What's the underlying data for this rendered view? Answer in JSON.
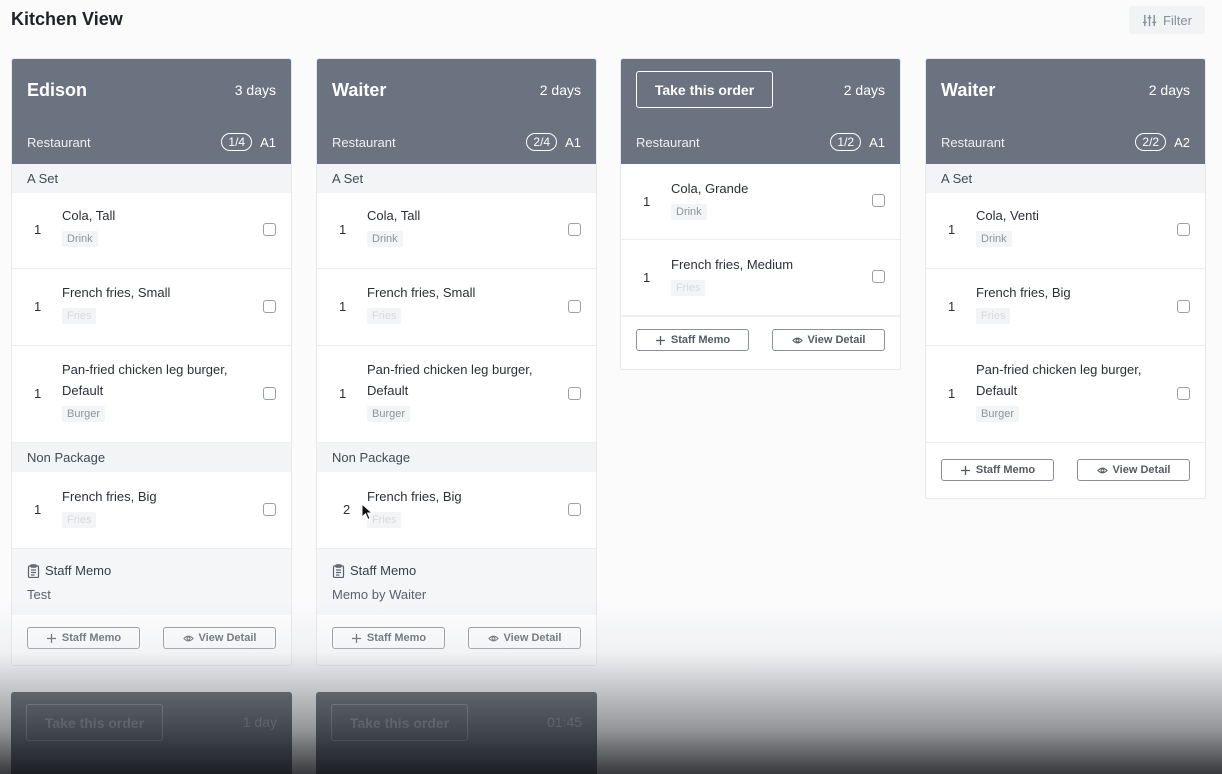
{
  "header": {
    "title": "Kitchen View",
    "filter_label": "Filter"
  },
  "cards": [
    {
      "name": "Edison",
      "days": "3 days",
      "restaurant": "Restaurant",
      "pill": "1/4",
      "table": "A1",
      "groups": [
        {
          "label": "A Set",
          "items": [
            {
              "qty": "1",
              "name": "Cola, Tall",
              "tag": "Drink"
            },
            {
              "qty": "1",
              "name": "French fries, Small",
              "tag": "Fries"
            },
            {
              "qty": "1",
              "name": "Pan-fried chicken leg burger, Default",
              "tag": "Burger"
            }
          ]
        },
        {
          "label": "Non Package",
          "items": [
            {
              "qty": "1",
              "name": "French fries, Big",
              "tag": "Fries"
            }
          ]
        }
      ],
      "memo_title": "Staff Memo",
      "memo_text": "Test",
      "staff_memo_label": "Staff Memo",
      "view_detail_label": "View Detail"
    },
    {
      "name": "Waiter",
      "days": "2 days",
      "restaurant": "Restaurant",
      "pill": "2/4",
      "table": "A1",
      "groups": [
        {
          "label": "A Set",
          "items": [
            {
              "qty": "1",
              "name": "Cola, Tall",
              "tag": "Drink"
            },
            {
              "qty": "1",
              "name": "French fries, Small",
              "tag": "Fries"
            },
            {
              "qty": "1",
              "name": "Pan-fried chicken leg burger, Default",
              "tag": "Burger"
            }
          ]
        },
        {
          "label": "Non Package",
          "items": [
            {
              "qty": "2",
              "name": "French fries, Big",
              "tag": "Fries"
            }
          ]
        }
      ],
      "memo_title": "Staff Memo",
      "memo_text": "Memo by Waiter",
      "staff_memo_label": "Staff Memo",
      "view_detail_label": "View Detail"
    },
    {
      "take_label": "Take this order",
      "days": "2 days",
      "restaurant": "Restaurant",
      "pill": "1/2",
      "table": "A1",
      "items": [
        {
          "qty": "1",
          "name": "Cola, Grande",
          "tag": "Drink"
        },
        {
          "qty": "1",
          "name": "French fries, Medium",
          "tag": "Fries"
        }
      ],
      "staff_memo_label": "Staff Memo",
      "view_detail_label": "View Detail"
    },
    {
      "name": "Waiter",
      "days": "2 days",
      "restaurant": "Restaurant",
      "pill": "2/2",
      "table": "A2",
      "groups": [
        {
          "label": "A Set",
          "items": [
            {
              "qty": "1",
              "name": "Cola, Venti",
              "tag": "Drink"
            },
            {
              "qty": "1",
              "name": "French fries, Big",
              "tag": "Fries"
            },
            {
              "qty": "1",
              "name": "Pan-fried chicken leg burger, Default",
              "tag": "Burger"
            }
          ]
        }
      ],
      "staff_memo_label": "Staff Memo",
      "view_detail_label": "View Detail"
    }
  ],
  "bottom_cards": [
    {
      "take_label": "Take this order",
      "time": "1 day"
    },
    {
      "take_label": "Take this order",
      "time": "01:45"
    }
  ],
  "colors": {
    "card_header": "#6b7280",
    "dark_card": "#4b5059"
  }
}
